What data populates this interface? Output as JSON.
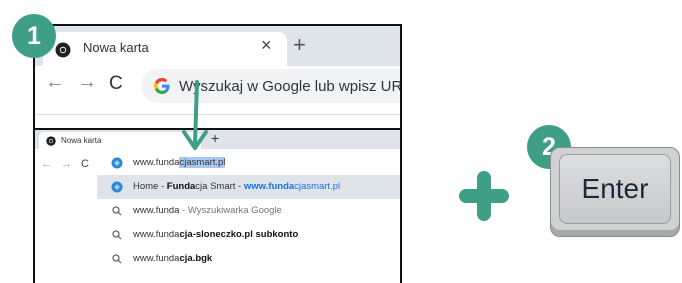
{
  "steps": {
    "one": "1",
    "two": "2"
  },
  "browser_top": {
    "tab_title": "Nowa karta",
    "tab_close": "×",
    "new_tab": "+",
    "nav_back": "←",
    "nav_forward": "→",
    "nav_reload": "C",
    "omnibox_placeholder": "Wyszukaj w Google lub wpisz URL"
  },
  "browser_bottom": {
    "tab_title": "Nowa karta",
    "new_tab": "+",
    "nav_back": "←",
    "nav_forward": "→",
    "nav_reload": "C",
    "input": {
      "typed": "www.funda",
      "autocomplete": "cjasmart.pl"
    },
    "suggestions": [
      {
        "pre": "Home - ",
        "bold": "Funda",
        "mid": "cja Smart - ",
        "url_bold": "www.funda",
        "url_rest": "cjasmart.pl",
        "icon": "site-favicon",
        "selected": true
      },
      {
        "pre": "www.funda",
        "gray": " - Wyszukiwarka Google",
        "icon": "search-icon"
      },
      {
        "pre": "www.funda",
        "bold": "cja-sloneczko.pl subkonto",
        "icon": "search-icon"
      },
      {
        "pre": "www.funda",
        "bold": "cja.bgk",
        "icon": "search-icon"
      }
    ]
  },
  "key": {
    "label": "Enter"
  },
  "colors": {
    "accent": "#3f9e86",
    "highlight": "#a9c7f1",
    "link": "#1a73e8"
  }
}
